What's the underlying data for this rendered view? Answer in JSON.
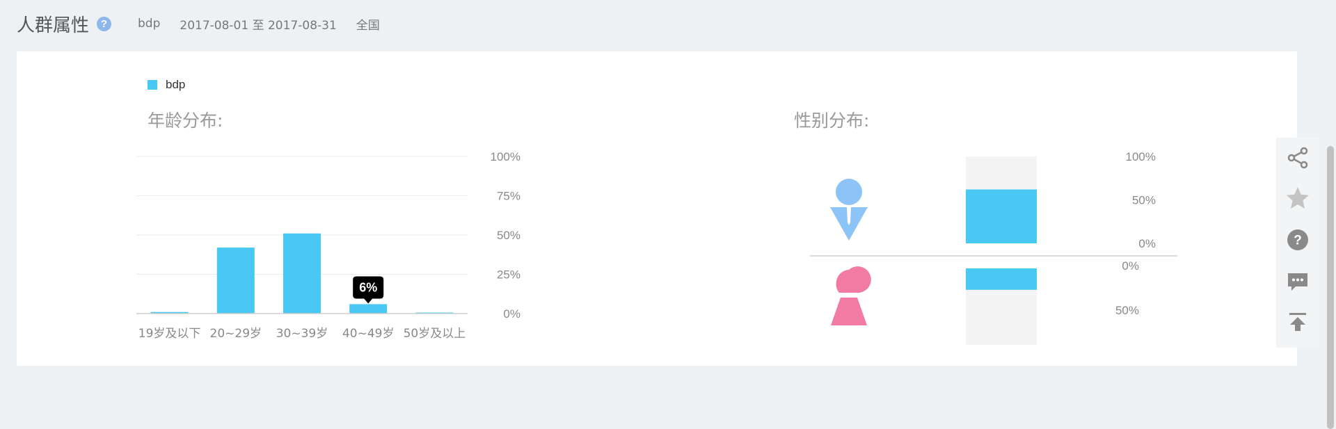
{
  "header": {
    "title": "人群属性",
    "help_icon": "question-circle-icon",
    "help_glyph": "?",
    "keyword": "bdp",
    "date_range": "2017-08-01 至 2017-08-31",
    "region": "全国"
  },
  "legend": {
    "label": "bdp",
    "color": "#48c8f3"
  },
  "colors": {
    "bar": "#48c8f3",
    "male": "#8cc4f7",
    "female": "#f27ba3",
    "track": "#f4f4f4",
    "tooltip": "#000000"
  },
  "chart_data": [
    {
      "type": "bar",
      "title": "年龄分布:",
      "categories": [
        "19岁及以下",
        "20~29岁",
        "30~39岁",
        "40~49岁",
        "50岁及以上"
      ],
      "values": [
        1,
        42,
        51,
        6,
        0.5
      ],
      "yticks": [
        "0%",
        "25%",
        "50%",
        "75%",
        "100%"
      ],
      "ylim": [
        0,
        100
      ],
      "tooltip": {
        "category": "40~49岁",
        "text": "6%"
      },
      "grid": true,
      "axis_position": "right"
    },
    {
      "type": "bar",
      "title": "性别分布:",
      "categories": [
        "男",
        "女"
      ],
      "icons": [
        "male-figure-icon",
        "female-figure-icon"
      ],
      "values": [
        62,
        28
      ],
      "male_ticks": [
        "100%",
        "50%",
        "0%"
      ],
      "female_ticks": [
        "0%",
        "50%"
      ],
      "ylim": [
        0,
        100
      ],
      "grid": false
    }
  ],
  "toolbar": [
    {
      "icon": "share-icon"
    },
    {
      "icon": "star-icon"
    },
    {
      "icon": "help-icon",
      "glyph": "?"
    },
    {
      "icon": "comment-icon"
    },
    {
      "icon": "back-to-top-icon"
    }
  ]
}
